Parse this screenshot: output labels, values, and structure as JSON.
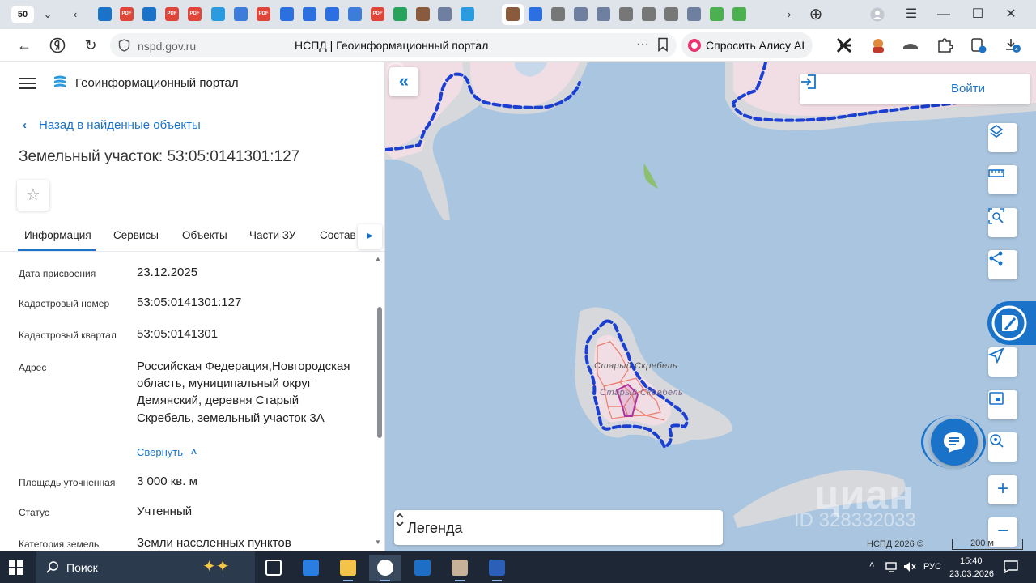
{
  "browser": {
    "tab_count": "50",
    "url_domain": "nspd.gov.ru",
    "page_title": "НСПД | Геоинформационный портал",
    "alice_label": "Спросить Алису AI",
    "tab_icon_label": "PDF"
  },
  "panel": {
    "portal_name": "Геоинформационный портал",
    "back_link": "Назад в найденные объекты",
    "title": "Земельный участок: 53:05:0141301:127",
    "tabs": [
      "Информация",
      "Сервисы",
      "Объекты",
      "Части ЗУ",
      "Состав"
    ],
    "rows": {
      "assign_date": {
        "label": "Дата присвоения",
        "value": "23.12.2025"
      },
      "cadastral_number": {
        "label": "Кадастровый номер",
        "value": "53:05:0141301:127"
      },
      "cadastral_block": {
        "label": "Кадастровый квартал",
        "value": "53:05:0141301"
      },
      "address": {
        "label": "Адрес",
        "value": "Российская Федерация,Новгородская область, муниципальный округ Демянский, деревня Старый Скребель, земельный участок 3А"
      },
      "area": {
        "label": "Площадь уточненная",
        "value": "3 000 кв. м"
      },
      "status": {
        "label": "Статус",
        "value": "Учтенный"
      },
      "land_category": {
        "label": "Категория земель",
        "value": "Земли населенных пунктов"
      }
    },
    "collapse_link": "Свернуть"
  },
  "map": {
    "login_label": "Войти",
    "legend_label": "Легенда",
    "place_label_1": "Старый Скребель",
    "place_label_2": "Старый Скребель",
    "watermark_brand": "циан",
    "watermark_id": "ID 328332033",
    "copyright": "НСПД 2026 ©",
    "scale_label": "200 м",
    "colors": {
      "water": "#aac5df",
      "land": "#d4d7dc",
      "boundary": "#1a3fd1",
      "parcel": "#e88070",
      "accent": "#1a73c8"
    }
  },
  "taskbar": {
    "search_label": "Поиск",
    "lang": "РУС",
    "time": "15:40",
    "date": "23.03.2026"
  }
}
